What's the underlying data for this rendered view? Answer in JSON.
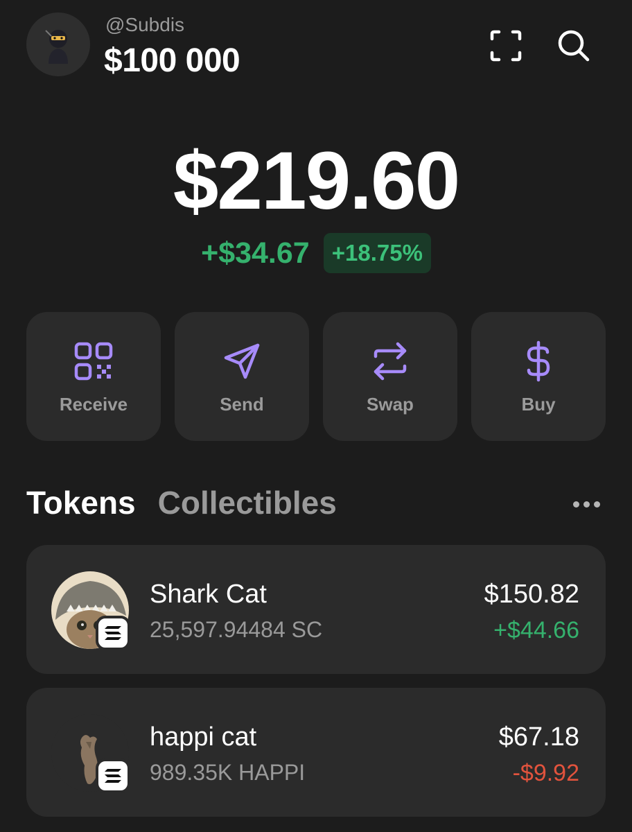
{
  "header": {
    "username": "@Subdis",
    "account_name": "$100 000",
    "avatar_icon": "ninja-avatar",
    "scan_icon": "scan-icon",
    "search_icon": "search-icon"
  },
  "balance": {
    "total": "$219.60",
    "change_abs": "+$34.67",
    "change_pct": "+18.75%"
  },
  "actions": [
    {
      "label": "Receive",
      "icon": "qr-code-icon"
    },
    {
      "label": "Send",
      "icon": "send-icon"
    },
    {
      "label": "Swap",
      "icon": "swap-icon"
    },
    {
      "label": "Buy",
      "icon": "dollar-icon"
    }
  ],
  "tabs": {
    "active": "Tokens",
    "inactive": "Collectibles",
    "more_icon": "more-icon"
  },
  "tokens": [
    {
      "name": "Shark Cat",
      "amount": "25,597.94484 SC",
      "value": "$150.82",
      "pnl": "+$44.66",
      "pnl_direction": "up"
    },
    {
      "name": "happi cat",
      "amount": "989.35K HAPPI",
      "value": "$67.18",
      "pnl": "-$9.92",
      "pnl_direction": "down"
    }
  ],
  "colors": {
    "background": "#1c1c1c",
    "card": "#2b2b2b",
    "accent": "#a78bfa",
    "positive": "#35b16d",
    "negative": "#e2533d"
  }
}
